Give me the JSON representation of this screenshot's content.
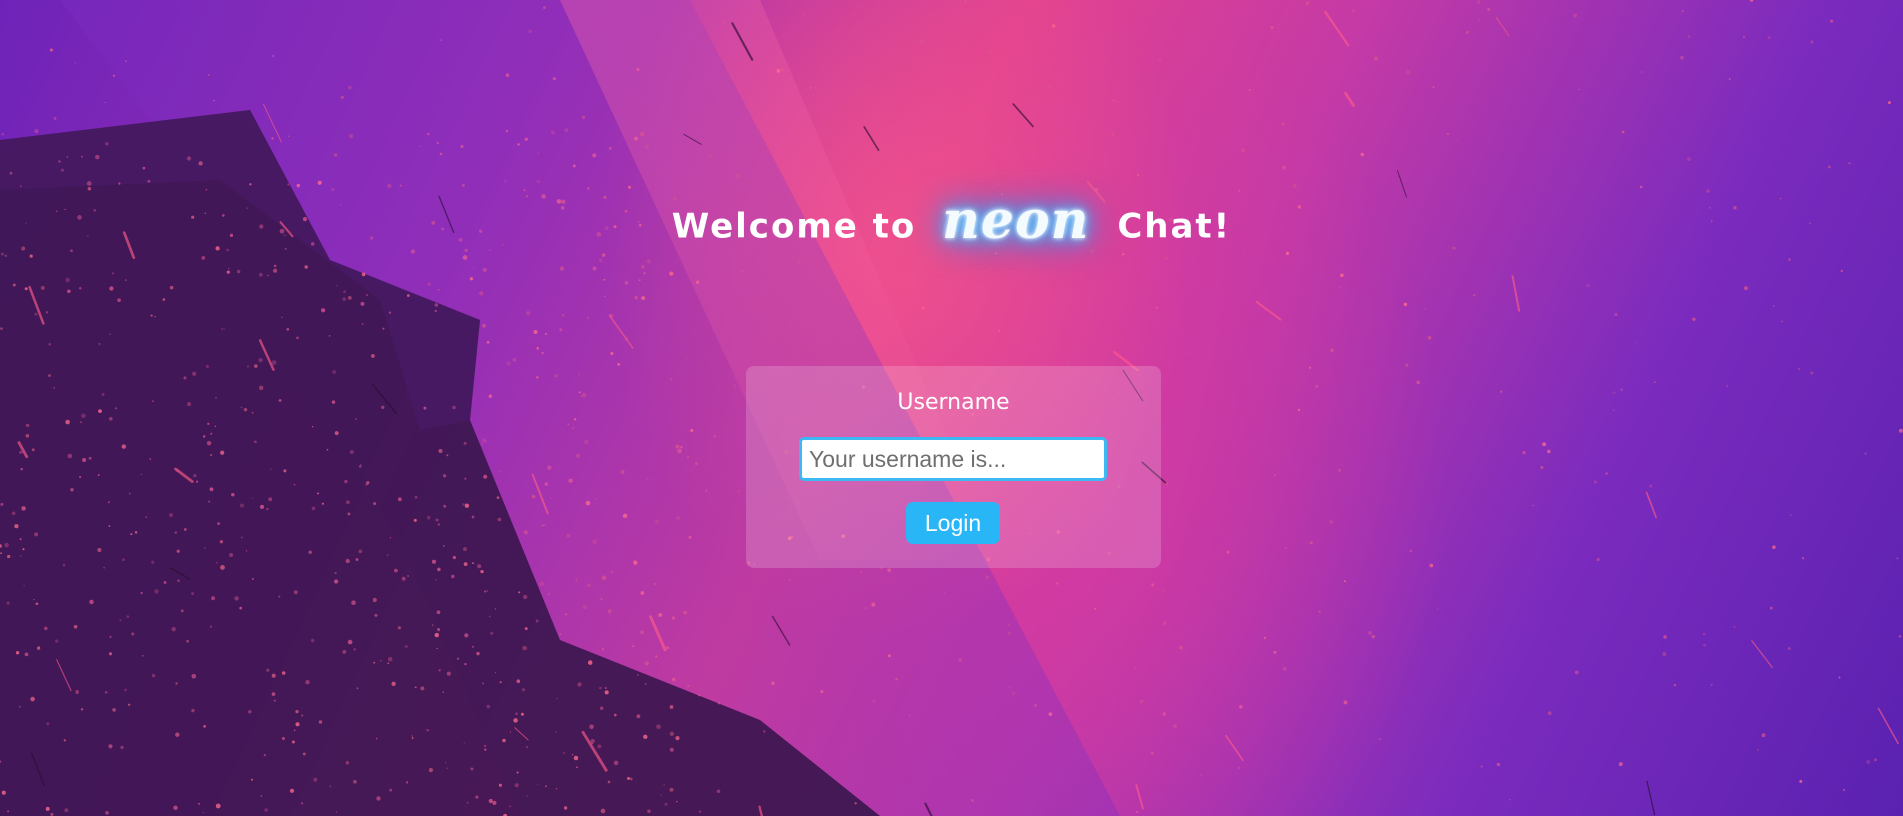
{
  "header": {
    "welcome_prefix": "Welcome to",
    "brand_word": "neon",
    "welcome_suffix": "Chat!"
  },
  "login_form": {
    "username_label": "Username",
    "username_placeholder": "Your username is...",
    "username_value": "",
    "login_button_label": "Login"
  },
  "colors": {
    "accent": "#29b6f6",
    "input_border": "#3cb8f3",
    "neon_glow": "#2bb4ff",
    "background_pink": "#e2428f",
    "background_purple": "#6e23b8"
  }
}
